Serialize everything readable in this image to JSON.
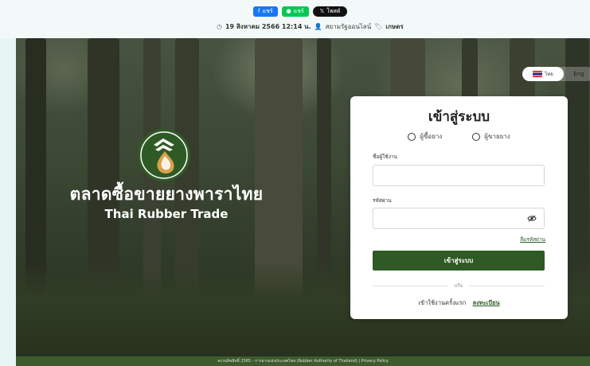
{
  "share": {
    "facebook_label": "แชร์",
    "line_label": "แชร์",
    "x_label": "โพสต์"
  },
  "meta": {
    "date": "19 สิงหาคม 2566 12:14 น.",
    "author": "สยามรัฐออนไลน์",
    "category": "เกษตร"
  },
  "brand": {
    "name_th": "ตลาดซื้อขายยางพาราไทย",
    "name_en": "Thai Rubber Trade"
  },
  "language": {
    "th_label": "ไทย",
    "en_label": "Eng"
  },
  "login": {
    "title": "เข้าสู่ระบบ",
    "role_buyer": "ผู้ซื้อยาง",
    "role_seller": "ผู้ขายยาง",
    "username_label": "ชื่อผู้ใช้งาน",
    "username_value": "",
    "password_label": "รหัสผ่าน",
    "password_value": "",
    "forgot_password": "ลืมรหัสผ่าน",
    "submit_label": "เข้าสู่ระบบ",
    "divider_text": "หรือ",
    "first_time_text": "เข้าใช้งานครั้งแรก",
    "register_link": "ลงทะเบียน"
  },
  "footer": {
    "copyright": "สงวนลิขสิทธิ์ 2565 - การยางแห่งประเทศไทย (Rubber Authority of Thailand)",
    "privacy": "Privacy Policy"
  },
  "colors": {
    "primary_green": "#2f5a25",
    "footer_green": "#3d5c2e",
    "facebook_blue": "#1877f2",
    "line_green": "#06c755"
  }
}
